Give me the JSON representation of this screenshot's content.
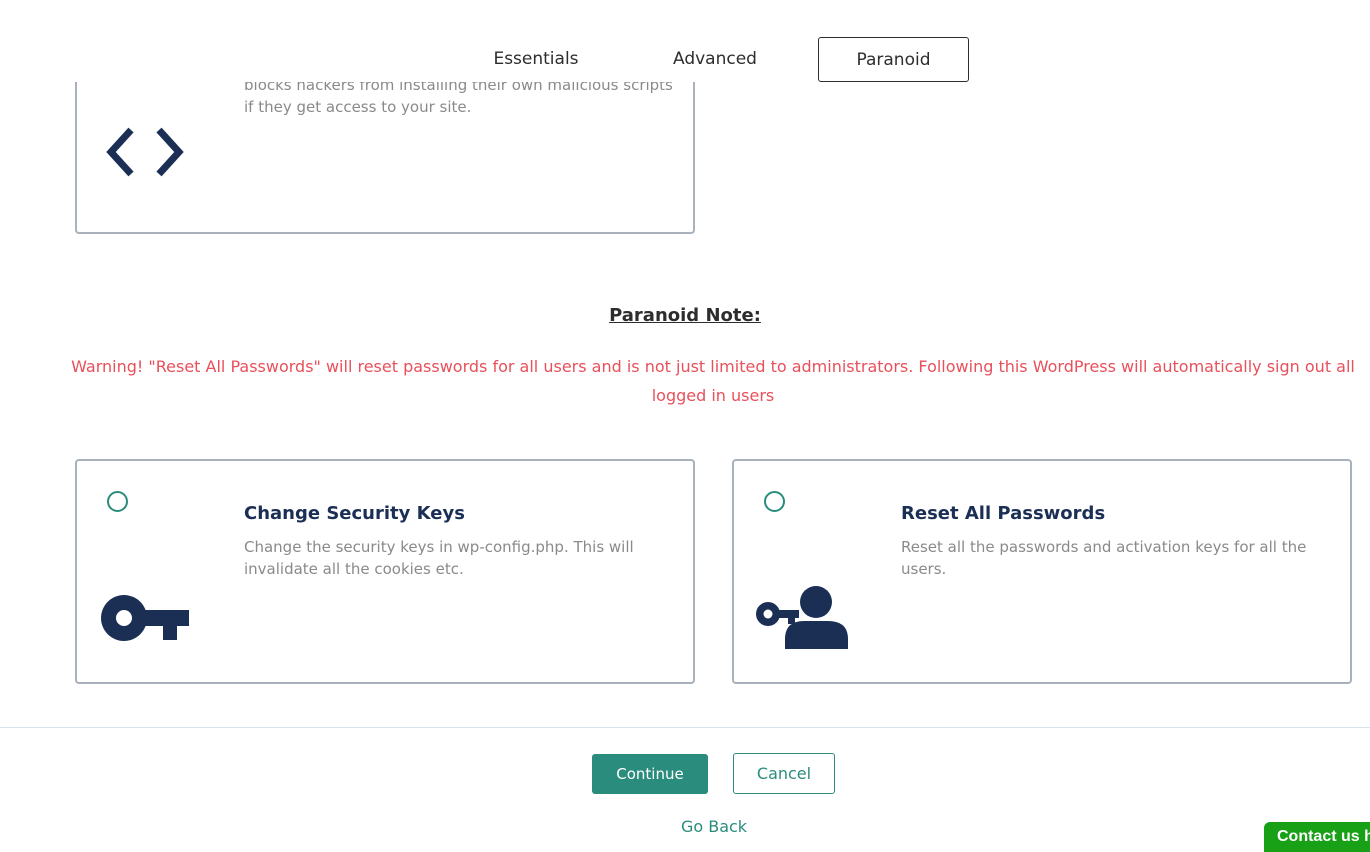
{
  "tabs": [
    "Essentials",
    "Advanced",
    "Paranoid"
  ],
  "top_card": {
    "description": "blocks hackers from installing their own malicious scripts if they get access to your site.",
    "icon": "code-brackets-icon"
  },
  "note": {
    "title": "Paranoid Note:",
    "text": "Warning! \"Reset All Passwords\" will reset passwords for all users and is not just limited to administrators. Following this WordPress will automatically sign out all logged in users"
  },
  "cards": [
    {
      "title": "Change Security Keys",
      "description": "Change the security keys in wp-config.php. This will invalidate all the cookies etc.",
      "icon": "key-icon",
      "selected": false
    },
    {
      "title": "Reset All Passwords",
      "description": "Reset all the passwords and activation keys for all the users.",
      "icon": "user-key-icon",
      "selected": false
    }
  ],
  "buttons": {
    "continue": "Continue",
    "cancel": "Cancel",
    "go_back": "Go Back"
  },
  "contact": "Contact us h",
  "colors": {
    "accent": "#2a8c7d",
    "navy": "#1b2f55",
    "warning": "#e8505b",
    "contact_bg": "#18a016"
  }
}
